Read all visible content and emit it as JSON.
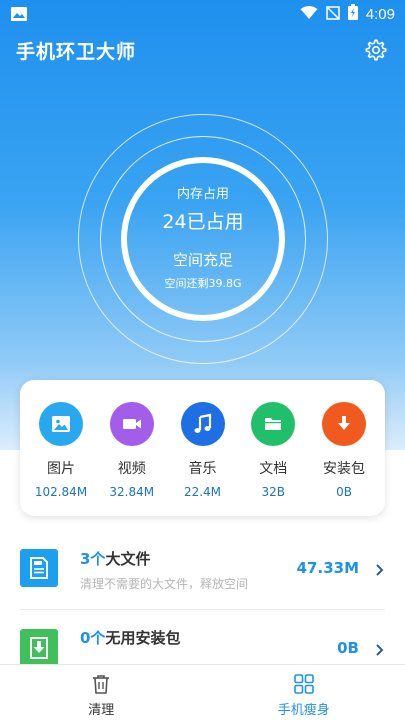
{
  "status_bar": {
    "time": "4:09"
  },
  "app": {
    "title": "手机环卫大师"
  },
  "memory": {
    "label": "内存占用",
    "used": "24已占用",
    "status": "空间充足",
    "remaining": "空间还剩39.8G"
  },
  "categories": [
    {
      "name": "图片",
      "size": "102.84M",
      "icon": "image-icon",
      "color": "#29a8ef"
    },
    {
      "name": "视频",
      "size": "32.84M",
      "icon": "video-icon",
      "color": "#a35de8"
    },
    {
      "name": "音乐",
      "size": "22.4M",
      "icon": "music-icon",
      "color": "#1d6fe3"
    },
    {
      "name": "文档",
      "size": "32B",
      "icon": "folder-icon",
      "color": "#1fc069"
    },
    {
      "name": "安装包",
      "size": "0B",
      "icon": "download-icon",
      "color": "#f05a1e"
    }
  ],
  "list": [
    {
      "count": "3个",
      "title": "大文件",
      "subtitle": "清理不需要的大文件，释放空间",
      "size": "47.33M",
      "icon": "big-file-icon",
      "color": "#1c9ff0"
    },
    {
      "count": "0个",
      "title": "无用安装包",
      "subtitle": "",
      "size": "0B",
      "icon": "apk-download-icon",
      "color": "#3fc05a"
    }
  ],
  "nav": [
    {
      "label": "清理",
      "icon": "trash-icon",
      "active": false
    },
    {
      "label": "手机瘦身",
      "icon": "grid-icon",
      "active": true
    }
  ]
}
